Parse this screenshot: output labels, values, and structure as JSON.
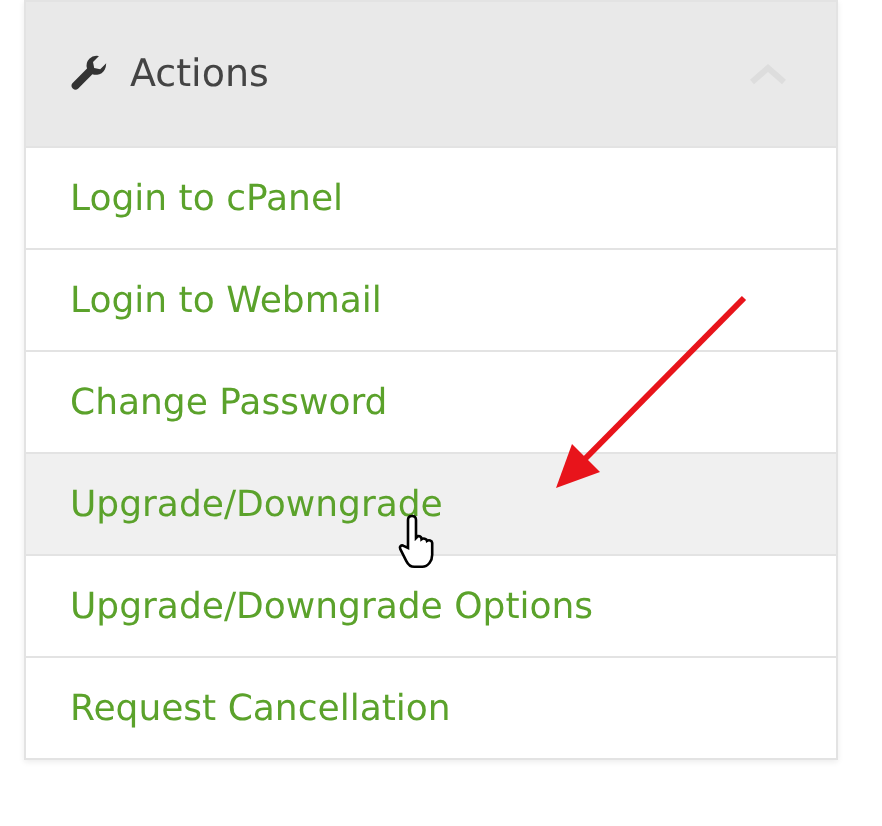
{
  "panel": {
    "title": "Actions",
    "expanded": true,
    "items": [
      {
        "label": "Login to cPanel",
        "hovered": false
      },
      {
        "label": "Login to Webmail",
        "hovered": false
      },
      {
        "label": "Change Password",
        "hovered": false
      },
      {
        "label": "Upgrade/Downgrade",
        "hovered": true
      },
      {
        "label": "Upgrade/Downgrade Options",
        "hovered": false
      },
      {
        "label": "Request Cancellation",
        "hovered": false
      }
    ]
  }
}
